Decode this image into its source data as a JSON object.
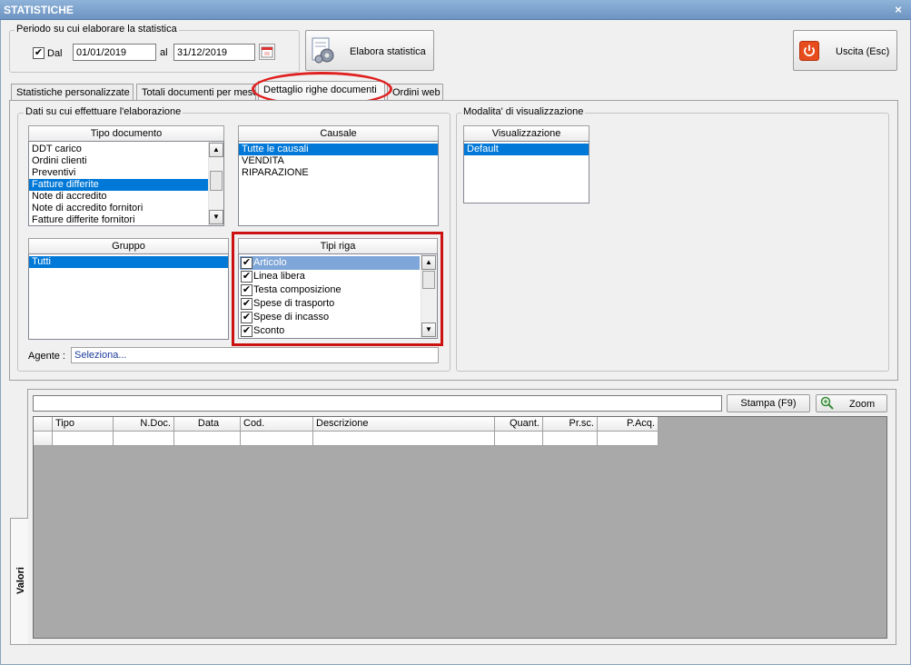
{
  "window": {
    "title": "STATISTICHE",
    "close_glyph": "×"
  },
  "period": {
    "group_label": "Periodo su cui elaborare la statistica",
    "dal_label": "Dal",
    "dal_checked": true,
    "date_from": "01/01/2019",
    "al_label": "al",
    "date_to": "31/12/2019"
  },
  "toolbar": {
    "elabora_label": "Elabora statistica",
    "exit_label": "Uscita (Esc)"
  },
  "tabs": [
    {
      "label": "Statistiche personalizzate"
    },
    {
      "label": "Totali documenti per mese"
    },
    {
      "label": "Dettaglio righe documenti"
    },
    {
      "label": "Ordini web"
    }
  ],
  "data_group": {
    "label": "Dati su cui effettuare l'elaborazione",
    "tipo_documento": {
      "header": "Tipo documento",
      "items": [
        "DDT carico",
        "Ordini clienti",
        "Preventivi",
        "Fatture differite",
        "Note di accredito",
        "Note di accredito fornitori",
        "Fatture differite fornitori"
      ],
      "selected": "Fatture differite"
    },
    "causale": {
      "header": "Causale",
      "items": [
        "Tutte le causali",
        "VENDITA",
        "RIPARAZIONE"
      ],
      "selected": "Tutte le causali"
    },
    "gruppo": {
      "header": "Gruppo",
      "items": [
        "Tutti"
      ],
      "selected": "Tutti"
    },
    "tipi_riga": {
      "header": "Tipi riga",
      "items": [
        "Articolo",
        "Linea libera",
        "Testa composizione",
        "Spese di trasporto",
        "Spese di incasso",
        "Sconto"
      ],
      "selected": "Articolo"
    },
    "agente_label": "Agente :",
    "agente_value": "Seleziona..."
  },
  "view_group": {
    "label": "Modalita' di visualizzazione",
    "visualizzazione": {
      "header": "Visualizzazione",
      "items": [
        "Default"
      ],
      "selected": "Default"
    }
  },
  "results": {
    "side_tab": "Valori",
    "stampa_label": "Stampa (F9)",
    "zoom_label": "Zoom",
    "columns": [
      "Tipo",
      "N.Doc.",
      "Data",
      "Cod.",
      "Descrizione",
      "Quant.",
      "Pr.sc.",
      "P.Acq."
    ]
  },
  "colors": {
    "selection": "#0078d7",
    "highlight_circle": "#e02020",
    "highlight_box": "#cc1111",
    "grid_bg": "#a9a9a9"
  }
}
